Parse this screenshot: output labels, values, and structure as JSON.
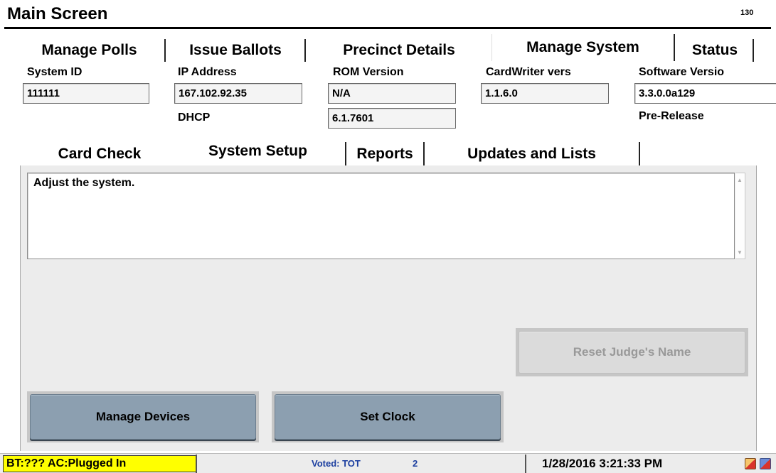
{
  "header": {
    "title": "Main Screen",
    "counter": "130"
  },
  "top_tabs": [
    {
      "label": "Manage Polls"
    },
    {
      "label": "Issue Ballots"
    },
    {
      "label": "Precinct Details"
    },
    {
      "label": "Manage System",
      "selected": true
    },
    {
      "label": "Status"
    }
  ],
  "info": {
    "system_id": {
      "label": "System ID",
      "value": "111111"
    },
    "ip_address": {
      "label": "IP Address",
      "value": "167.102.92.35",
      "sub_label": "DHCP"
    },
    "rom_version": {
      "label": "ROM Version",
      "value": "N/A",
      "sub_value": "6.1.7601"
    },
    "cardwriter": {
      "label": "CardWriter vers",
      "value": "1.1.6.0"
    },
    "software": {
      "label": "Software Versio",
      "value": "3.3.0.0a129",
      "sub_label": "Pre-Release"
    }
  },
  "sub_tabs": [
    {
      "label": "Card Check"
    },
    {
      "label": "System Setup",
      "selected": true
    },
    {
      "label": "Reports"
    },
    {
      "label": "Updates and Lists"
    }
  ],
  "content": {
    "description": "Adjust the system."
  },
  "buttons": {
    "reset_judge": {
      "label": "Reset Judge's Name",
      "enabled": false
    },
    "manage_devices": {
      "label": "Manage Devices"
    },
    "set_clock": {
      "label": "Set Clock"
    }
  },
  "statusbar": {
    "battery": "BT:??? AC:Plugged In",
    "voted_label": "Voted: TOT",
    "voted_value": "2",
    "datetime": "1/28/2016 3:21:33 PM",
    "battery_color": "#ffff00",
    "voted_color": "#1c3fa0"
  },
  "icons": [
    "scroll-up-arrow-icon",
    "scroll-down-arrow-icon",
    "tray-network-icon",
    "tray-alert-icon"
  ]
}
